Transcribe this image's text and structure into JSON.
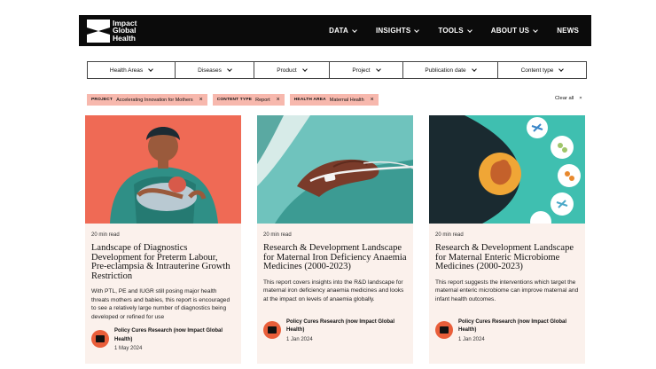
{
  "header": {
    "logo_lines": [
      "Impact",
      "Global",
      "Health"
    ],
    "nav": [
      {
        "label": "DATA",
        "has_dropdown": true
      },
      {
        "label": "INSIGHTS",
        "has_dropdown": true
      },
      {
        "label": "TOOLS",
        "has_dropdown": true
      },
      {
        "label": "ABOUT US",
        "has_dropdown": true
      },
      {
        "label": "NEWS",
        "has_dropdown": false
      }
    ]
  },
  "filters": [
    "Health Areas",
    "Diseases",
    "Product",
    "Project",
    "Publication date",
    "Content type"
  ],
  "active_tags": [
    {
      "key": "PROJECT",
      "value": "Accelerating Innovation for Mothers"
    },
    {
      "key": "CONTENT TYPE",
      "value": "Report"
    },
    {
      "key": "HEALTH AREA",
      "value": "Maternal Health"
    }
  ],
  "clear_all_label": "Clear all",
  "cards": [
    {
      "read_time": "20 min read",
      "title": "Landscape of Diagnostics Development for Preterm Labour, Pre-eclampsia & Intrauterine Growth Restriction",
      "description": "With PTL, PE and IUGR still posing major health threats mothers and babies, this report is encouraged to see a relatively large number of diagnostics being developed or refined for use",
      "author": "Policy Cures Research (now Impact Global Health)",
      "date": "1 May 2024"
    },
    {
      "read_time": "20 min read",
      "title": "Research & Development Landscape for Maternal Iron Deficiency Anaemia Medicines (2000-2023)",
      "description": "This report covers insights into the R&D landscape for maternal iron deficiency anaemia medicines and looks at the impact on levels of anaemia globally.",
      "author": "Policy Cures Research (now Impact Global Health)",
      "date": "1 Jan 2024"
    },
    {
      "read_time": "20 min read",
      "title": "Research & Development Landscape for Maternal Enteric Microbiome Medicines (2000-2023)",
      "description": "This report suggests the interventions which target the maternal enteric microbiome can improve maternal and infant health outcomes.",
      "author": "Policy Cures Research (now Impact Global Health)",
      "date": "1 Jan 2024"
    }
  ]
}
